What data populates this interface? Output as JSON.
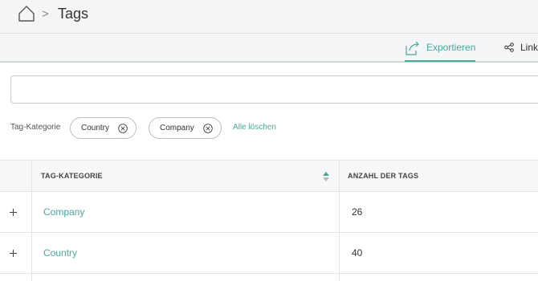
{
  "breadcrumb": {
    "separator": ">",
    "title": "Tags"
  },
  "toolbar": {
    "export_label": "Exportieren",
    "link_label": "Link"
  },
  "search": {
    "value": "",
    "placeholder": ""
  },
  "filters": {
    "label": "Tag-Kategorie",
    "chips": [
      {
        "label": "Country"
      },
      {
        "label": "Company"
      }
    ],
    "clear_all": "Alle löschen"
  },
  "table": {
    "columns": [
      "TAG-KATEGORIE",
      "ANZAHL DER TAGS"
    ],
    "rows": [
      {
        "name": "Company",
        "count": "26"
      },
      {
        "name": "Country",
        "count": "40"
      }
    ]
  },
  "colors": {
    "accent": "#4aa99d",
    "header_bg": "#f4f5f6",
    "border": "#dcdfe2"
  }
}
